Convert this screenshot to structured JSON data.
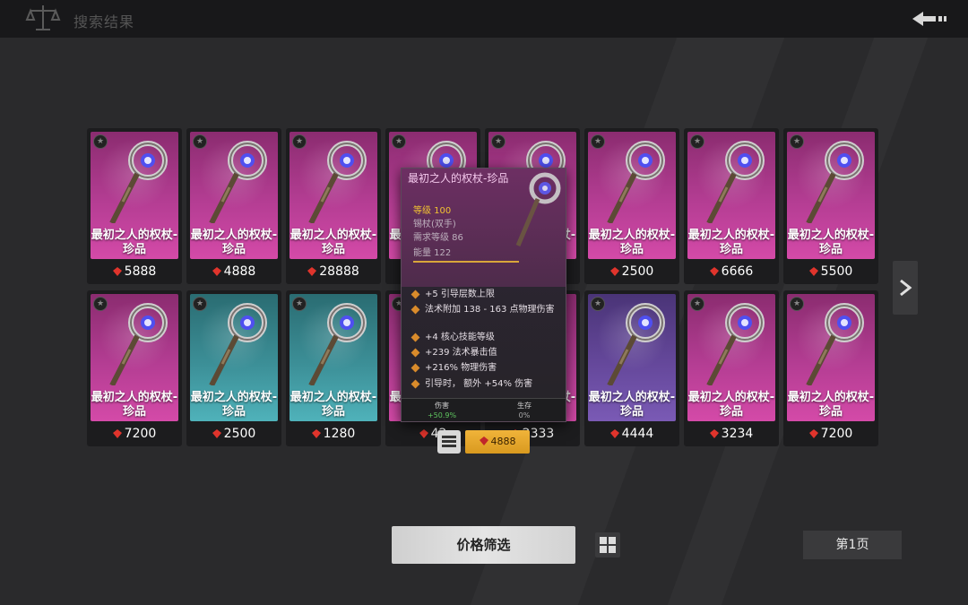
{
  "header": {
    "title": "搜索结果",
    "icons": {
      "scale": "scale-icon",
      "back": "back-arrow-icon"
    }
  },
  "colors": {
    "pink": "#b43d93",
    "teal": "#3c8f97",
    "purple": "#65489b",
    "gold": "#f1c232",
    "gem": "#e0342c"
  },
  "cards": [
    {
      "name": "最初之人的权杖-珍品",
      "price": "5888",
      "rarity": "pink"
    },
    {
      "name": "最初之人的权杖-珍品",
      "price": "4888",
      "rarity": "pink"
    },
    {
      "name": "最初之人的权杖-珍品",
      "price": "28888",
      "rarity": "pink"
    },
    {
      "name": "最初之人的权杖-珍品",
      "price": "",
      "rarity": "pink"
    },
    {
      "name": "最初之人的权杖-珍品",
      "price": "",
      "rarity": "pink"
    },
    {
      "name": "最初之人的权杖-珍品",
      "price": "2500",
      "rarity": "pink"
    },
    {
      "name": "最初之人的权杖-珍品",
      "price": "6666",
      "rarity": "pink"
    },
    {
      "name": "最初之人的权杖-珍品",
      "price": "5500",
      "rarity": "pink"
    },
    {
      "name": "最初之人的权杖-珍品",
      "price": "7200",
      "rarity": "pink"
    },
    {
      "name": "最初之人的权杖-珍品",
      "price": "2500",
      "rarity": "teal"
    },
    {
      "name": "最初之人的权杖-珍品",
      "price": "1280",
      "rarity": "teal"
    },
    {
      "name": "最初之人的权杖-珍品",
      "price": "42",
      "rarity": "pink"
    },
    {
      "name": "最初之人的权杖-珍品",
      "price": "2333",
      "rarity": "pink"
    },
    {
      "name": "最初之人的权杖-珍品",
      "price": "4444",
      "rarity": "purple"
    },
    {
      "name": "最初之人的权杖-珍品",
      "price": "3234",
      "rarity": "pink"
    },
    {
      "name": "最初之人的权杖-珍品",
      "price": "7200",
      "rarity": "pink"
    }
  ],
  "tooltip": {
    "name": "最初之人的权杖-珍品",
    "level": "等级 100",
    "type": "锡杖(双手)",
    "requirement": "需求等级 86",
    "power": "能量 122",
    "affixes": [
      "+5 引导层数上限",
      "法术附加 138 - 163 点物理伤害",
      "+4 核心技能等级",
      "+239 法术暴击值",
      "+216% 物理伤害",
      "引导时， 额外 +54% 伤害"
    ],
    "damage_label": "伤害",
    "damage_value": "+50.9%",
    "survival_label": "生存",
    "survival_value": "0%",
    "buy_price": "4888"
  },
  "footer": {
    "filter_label": "价格筛选",
    "page_label": "第1页"
  }
}
